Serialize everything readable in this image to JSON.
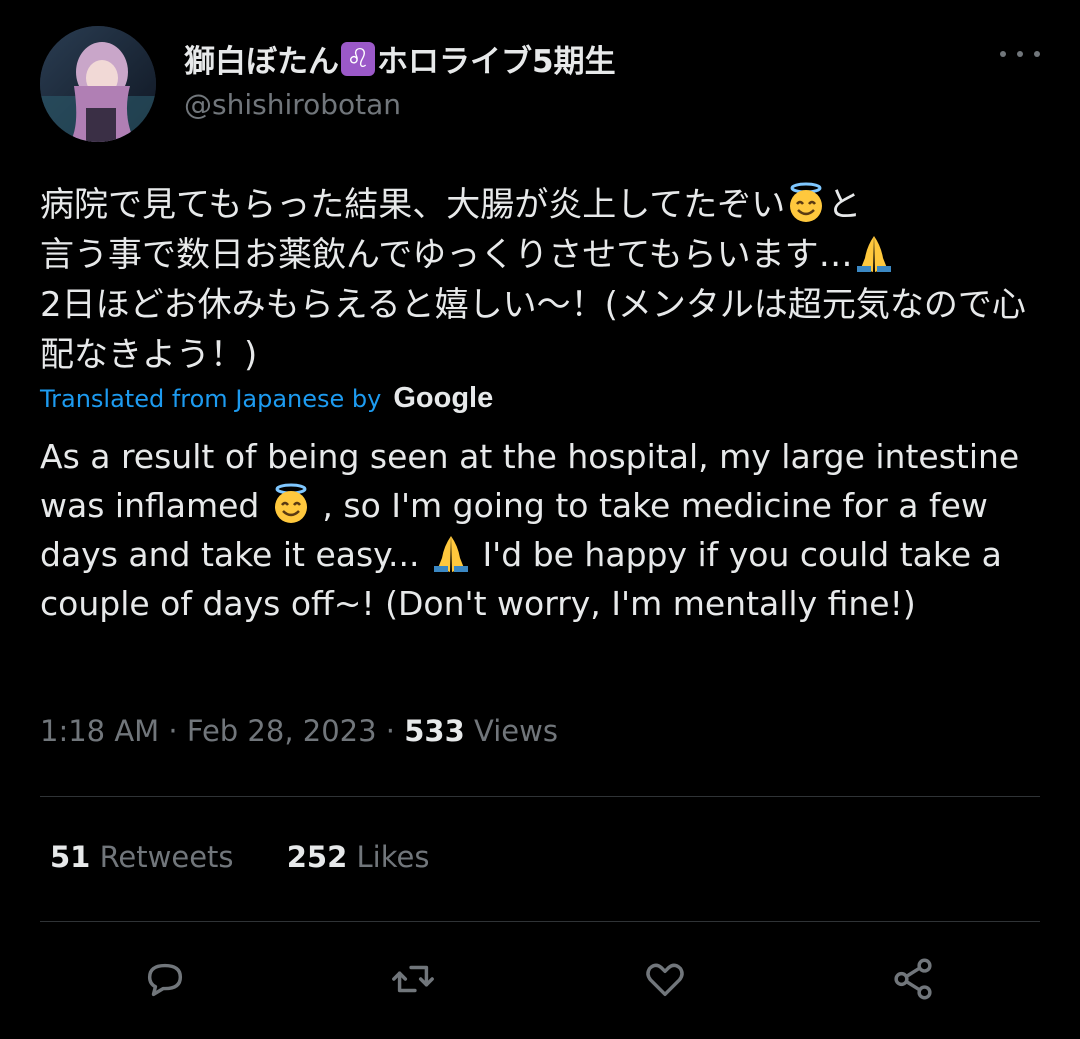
{
  "author": {
    "display_name_prefix": "獅白ぼたん",
    "badge_glyph": "♌",
    "display_name_suffix": "ホロライブ5期生",
    "handle": "@shishirobotan",
    "avatar": "avatar-image"
  },
  "tweet": {
    "original_line1": "病院で見てもらった結果、大腸が炎上してたぞい",
    "original_line1_end": "と",
    "original_line2": "言う事で数日お薬飲んでゆっくりさせてもらいます…",
    "original_rest": "2日ほどお休みもらえると嬉しい〜！(メンタルは超元気なので心配なきよう！)",
    "translated_label": "Translated from Japanese by",
    "translator": "Google",
    "translation_part1": "As a result of being seen at the hospital, my large intestine was inflamed",
    "translation_part2": ", so I'm going to take medicine for a few days and take it easy...",
    "translation_part3": "I'd be happy if you could take a couple of days off~! (Don't worry, I'm mentally fine!)",
    "emoji_1": "smiling-face-with-halo-icon",
    "emoji_2": "folded-hands-icon"
  },
  "meta": {
    "time": "1:18 AM",
    "sep": " · ",
    "date": "Feb 28, 2023",
    "views_count": "533",
    "views_label": "Views"
  },
  "stats": {
    "retweets_count": "51",
    "retweets_label": "Retweets",
    "likes_count": "252",
    "likes_label": "Likes"
  },
  "actions": [
    "reply-icon",
    "retweet-icon",
    "like-icon",
    "share-icon"
  ],
  "colors": {
    "background": "#000000",
    "text": "#e7e9ea",
    "secondary": "#71767b",
    "link": "#1d9bf0",
    "divider": "#2f3336"
  }
}
